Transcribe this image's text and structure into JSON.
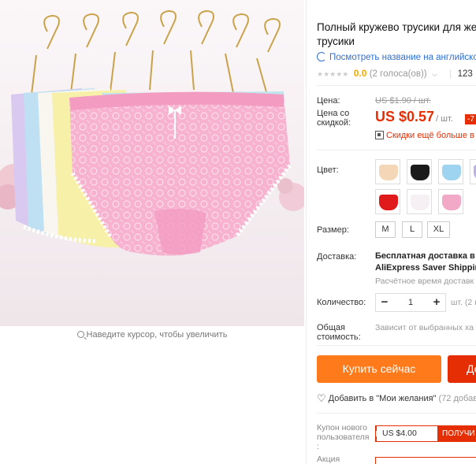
{
  "product": {
    "title": "Полный кружево трусики для женщин трусики",
    "translate_link": "Посмотреть название на английском",
    "rating_value": "0.0",
    "rating_count": "(2 голоса(ов))",
    "orders_partial": "123"
  },
  "gallery": {
    "zoom_hint": "Наведите курсор, чтобы увеличить"
  },
  "pricing": {
    "price_label": "Цена:",
    "old_price": "US $1.90 / шт.",
    "discount_price_label": "Цена со скидкой:",
    "new_price": "US $0.57",
    "unit": "/ шт.",
    "discount_badge": "-7",
    "promo_text": "Скидки ещё больше в"
  },
  "options": {
    "color_label": "Цвет:",
    "swatch_colors": [
      "#f3d7b6",
      "#1a1a1a",
      "#9fd4f0",
      "#bdb0e6",
      "#e01a1a",
      "#f6f0f4",
      "#f2a9c8"
    ],
    "size_label": "Размер:",
    "sizes": [
      "M",
      "L",
      "XL"
    ]
  },
  "shipping": {
    "label": "Доставка:",
    "line1": "Бесплатная доставка в Р",
    "line2": "AliExpress Saver Shipping",
    "line3": "Расчётное время доставк"
  },
  "quantity": {
    "label": "Количество:",
    "minus": "−",
    "value": "1",
    "plus": "+",
    "unit_note": "шт. (2 н"
  },
  "total": {
    "label": "Общая стоимость:",
    "note": "Зависит от выбранных ха"
  },
  "actions": {
    "buy_now": "Купить сейчас",
    "add_to_cart": "До",
    "wishlist": "Добавить в \"Мои желания\"",
    "wishlist_count": "(72 добав"
  },
  "coupon": {
    "label": "Купон нового пользователя :",
    "value": "US $4.00",
    "get": "ПОЛУЧИ",
    "promo_label": "Акция"
  },
  "colors": {
    "accent_red": "#e62e04",
    "accent_orange": "#ff7a1a",
    "link_blue": "#2f6fd6",
    "rating_orange": "#f7a800"
  }
}
